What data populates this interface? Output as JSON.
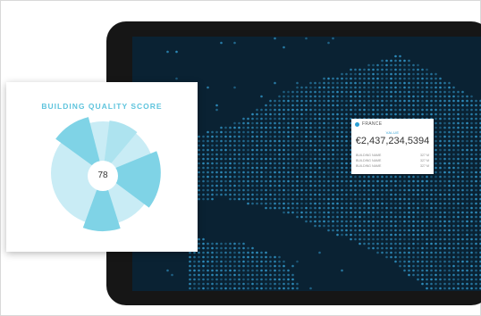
{
  "card": {
    "title": "BUILDING QUALITY SCORE",
    "score": "78",
    "colors": {
      "dark": "#7fd3e6",
      "light": "#c9ecf5"
    }
  },
  "tooltip": {
    "country": "FRANCE",
    "value_label": "VALUE",
    "value": "€2,437,234,5394",
    "rows": [
      {
        "name": "BUILDING NAME",
        "val": "327 M"
      },
      {
        "name": "BUILDING NAME",
        "val": "327 M"
      },
      {
        "name": "BUILDING NAME",
        "val": "327 M"
      }
    ]
  },
  "map": {
    "background": "#0a2233",
    "dot_color": "#2f8fbf"
  }
}
